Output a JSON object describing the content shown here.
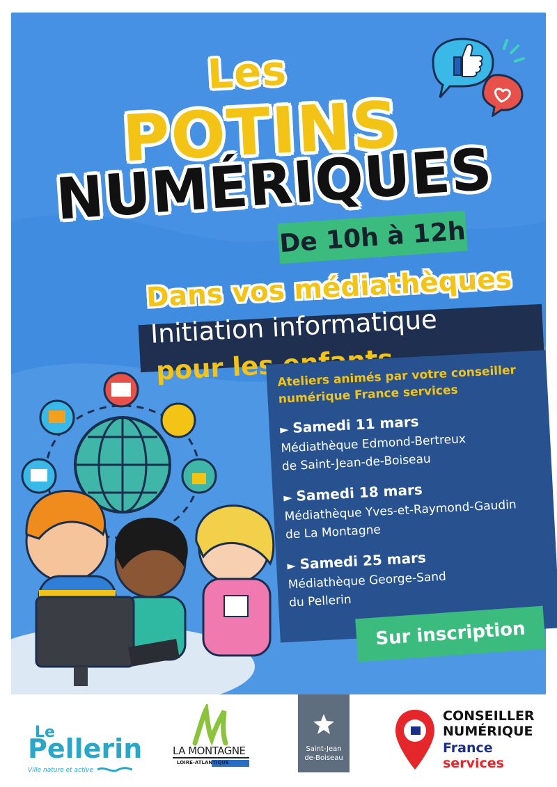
{
  "title": {
    "line1": "Les",
    "line2": "POTINS",
    "line3": "NUMÉRIQUES"
  },
  "hours": "De 10h à 12h",
  "subtitle": "Dans vos médiathèques",
  "headline": {
    "line1": "Initiation informatique",
    "line2": "pour les enfants"
  },
  "info": {
    "intro_line1": "Ateliers animés par votre conseiller",
    "intro_line2": "numérique France services",
    "sessions": [
      {
        "date": "Samedi 11 mars",
        "place_line1": "Médiathèque Edmond-Bertreux",
        "place_line2": "de Saint-Jean-de-Boiseau"
      },
      {
        "date": "Samedi 18 mars",
        "place_line1": "Médiathèque Yves-et-Raymond-Gaudin",
        "place_line2": "de La Montagne"
      },
      {
        "date": "Samedi 25 mars",
        "place_line1": "Médiathèque George-Sand",
        "place_line2": "du Pellerin"
      }
    ]
  },
  "registration": "Sur inscription",
  "logos": {
    "pellerin": {
      "le": "Le",
      "name": "Pellerin",
      "tagline": "Ville nature et active"
    },
    "montagne": {
      "name": "LA MONTAGNE",
      "region": "LOIRE-ATLANTIQUE"
    },
    "boiseau": {
      "line1": "Saint-Jean",
      "line2": "de-Boiseau"
    },
    "conseiller": {
      "line1": "CONSEILLER",
      "line2": "NUMÉRIQUE",
      "line3": "France",
      "line4": "services"
    }
  },
  "colors": {
    "background_blue": "#3f8ce0",
    "yellow": "#f3c316",
    "green": "#3bbb7d",
    "navy": "#1e2f4f",
    "info_blue": "#27528f"
  }
}
